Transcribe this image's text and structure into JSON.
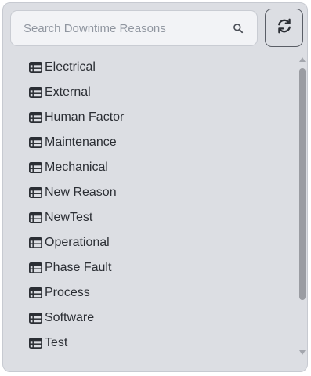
{
  "search": {
    "placeholder": "Search Downtime Reasons",
    "value": "",
    "icon": "search-icon"
  },
  "toolbar": {
    "refresh_icon": "refresh-icon"
  },
  "list": {
    "item_icon": "list-table-icon",
    "items": [
      {
        "label": "Electrical"
      },
      {
        "label": "External"
      },
      {
        "label": "Human Factor"
      },
      {
        "label": "Maintenance"
      },
      {
        "label": "Mechanical"
      },
      {
        "label": "New Reason"
      },
      {
        "label": "NewTest"
      },
      {
        "label": "Operational"
      },
      {
        "label": "Phase Fault"
      },
      {
        "label": "Process"
      },
      {
        "label": "Software"
      },
      {
        "label": "Test"
      }
    ]
  },
  "colors": {
    "panel_bg": "#dcdee3",
    "text": "#2b2e34",
    "placeholder": "#9096a0",
    "scroll_thumb": "#9a9ca2"
  }
}
